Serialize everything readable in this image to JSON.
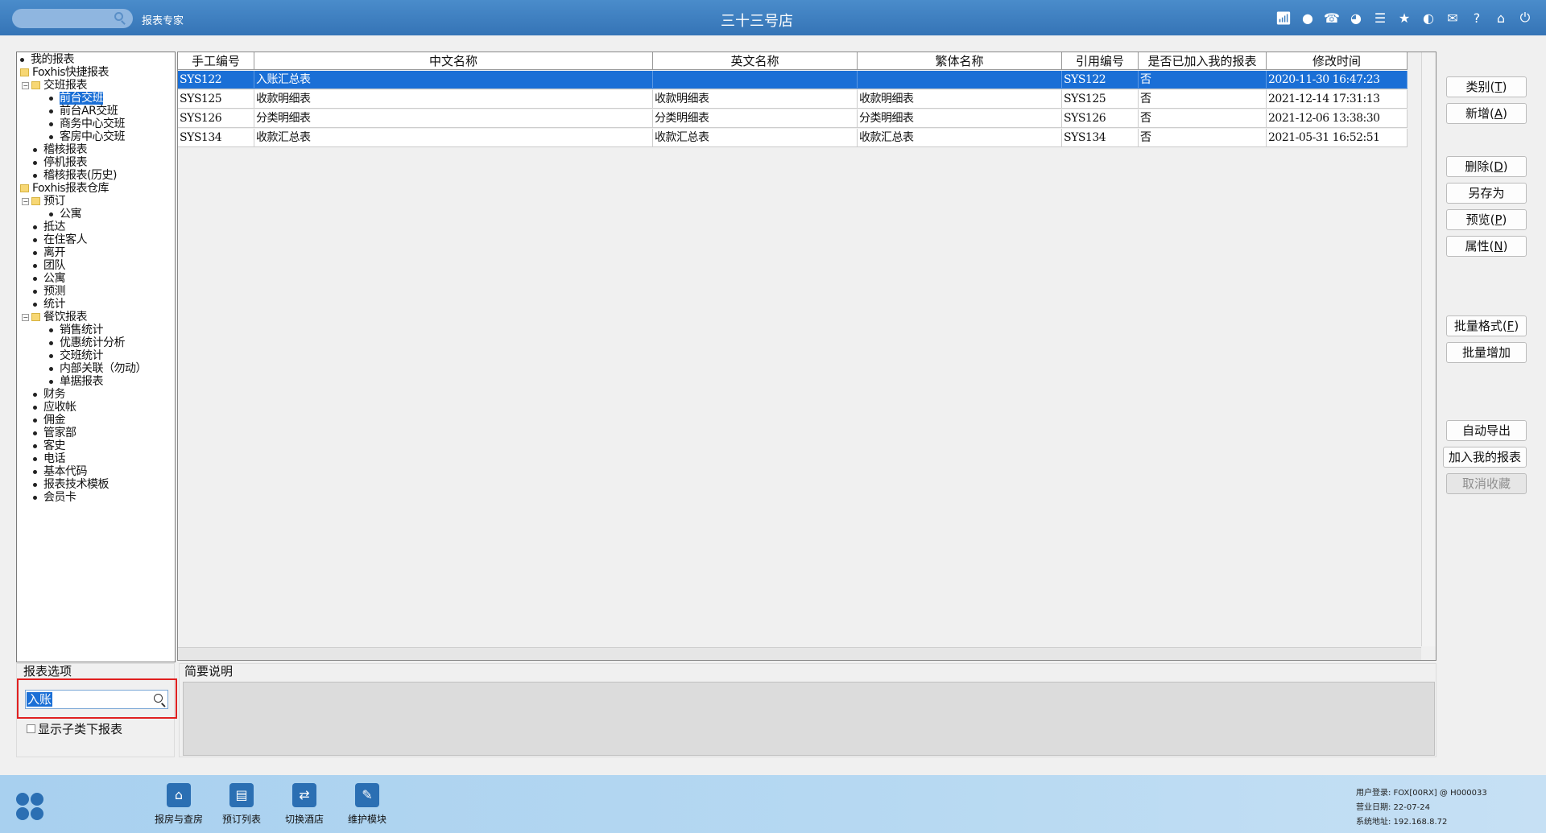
{
  "topbar": {
    "app_name": "报表专家",
    "hotel_name": "三十三号店",
    "icons": [
      "wifi-icon",
      "chat-icon",
      "phone-icon",
      "palette-icon",
      "menu-icon",
      "star-icon",
      "theme-icon",
      "mail-icon",
      "help-icon",
      "home-icon",
      "power-icon"
    ]
  },
  "tree": {
    "items": [
      {
        "label": "我的报表",
        "level": 0,
        "type": "bullet"
      },
      {
        "label": "Foxhis快捷报表",
        "level": 0,
        "type": "folder"
      },
      {
        "label": "交班报表",
        "level": 1,
        "type": "folder",
        "toggle": "⊟"
      },
      {
        "label": "前台交班",
        "level": 2,
        "type": "bullet",
        "selected": true
      },
      {
        "label": "前台AR交班",
        "level": 2,
        "type": "bullet"
      },
      {
        "label": "商务中心交班",
        "level": 2,
        "type": "bullet"
      },
      {
        "label": "客房中心交班",
        "level": 2,
        "type": "bullet"
      },
      {
        "label": "稽核报表",
        "level": 1,
        "type": "bullet"
      },
      {
        "label": "停机报表",
        "level": 1,
        "type": "bullet"
      },
      {
        "label": "稽核报表(历史)",
        "level": 1,
        "type": "bullet"
      },
      {
        "label": "Foxhis报表仓库",
        "level": 0,
        "type": "folder"
      },
      {
        "label": "预订",
        "level": 1,
        "type": "folder",
        "toggle": "⊟"
      },
      {
        "label": "公寓",
        "level": 2,
        "type": "bullet"
      },
      {
        "label": "抵达",
        "level": 1,
        "type": "bullet"
      },
      {
        "label": "在住客人",
        "level": 1,
        "type": "bullet"
      },
      {
        "label": "离开",
        "level": 1,
        "type": "bullet"
      },
      {
        "label": "团队",
        "level": 1,
        "type": "bullet"
      },
      {
        "label": "公寓",
        "level": 1,
        "type": "bullet"
      },
      {
        "label": "预测",
        "level": 1,
        "type": "bullet"
      },
      {
        "label": "统计",
        "level": 1,
        "type": "bullet"
      },
      {
        "label": "餐饮报表",
        "level": 1,
        "type": "folder",
        "toggle": "⊟"
      },
      {
        "label": "销售统计",
        "level": 2,
        "type": "bullet"
      },
      {
        "label": "优惠统计分析",
        "level": 2,
        "type": "bullet"
      },
      {
        "label": "交班统计",
        "level": 2,
        "type": "bullet"
      },
      {
        "label": "内部关联（勿动）",
        "level": 2,
        "type": "bullet"
      },
      {
        "label": "单据报表",
        "level": 2,
        "type": "bullet"
      },
      {
        "label": "财务",
        "level": 1,
        "type": "bullet"
      },
      {
        "label": "应收帐",
        "level": 1,
        "type": "bullet"
      },
      {
        "label": "佣金",
        "level": 1,
        "type": "bullet"
      },
      {
        "label": "管家部",
        "level": 1,
        "type": "bullet"
      },
      {
        "label": "客史",
        "level": 1,
        "type": "bullet"
      },
      {
        "label": "电话",
        "level": 1,
        "type": "bullet"
      },
      {
        "label": "基本代码",
        "level": 1,
        "type": "bullet"
      },
      {
        "label": "报表技术模板",
        "level": 1,
        "type": "bullet"
      },
      {
        "label": "会员卡",
        "level": 1,
        "type": "bullet"
      }
    ]
  },
  "grid": {
    "columns": [
      "手工编号",
      "中文名称",
      "英文名称",
      "繁体名称",
      "引用编号",
      "是否已加入我的报表",
      "修改时间"
    ],
    "rows": [
      [
        "SYS122",
        "入账汇总表",
        "",
        "",
        "SYS122",
        "否",
        "2020-11-30 16:47:23"
      ],
      [
        "SYS125",
        "收款明细表",
        "收款明细表",
        "收款明细表",
        "SYS125",
        "否",
        "2021-12-14 17:31:13"
      ],
      [
        "SYS126",
        "分类明细表",
        "分类明细表",
        "分类明细表",
        "SYS126",
        "否",
        "2021-12-06 13:38:30"
      ],
      [
        "SYS134",
        "收款汇总表",
        "收款汇总表",
        "收款汇总表",
        "SYS134",
        "否",
        "2021-05-31 16:52:51"
      ]
    ]
  },
  "buttons": {
    "category": {
      "text": "类别(",
      "key": "T",
      "end": ")"
    },
    "add": {
      "text": "新增(",
      "key": "A",
      "end": ")"
    },
    "delete": {
      "text": "删除(",
      "key": "D",
      "end": ")"
    },
    "save_as": {
      "text": "另存为"
    },
    "preview": {
      "text": "预览(",
      "key": "P",
      "end": ")"
    },
    "properties": {
      "text": "属性(",
      "key": "N",
      "end": ")"
    },
    "batch_format": {
      "text": "批量格式(",
      "key": "F",
      "end": ")"
    },
    "batch_add": {
      "text": "批量增加"
    },
    "auto_export": {
      "text": "自动导出"
    },
    "add_to_my_reports": {
      "text": "加入我的报表"
    },
    "cancel_favorite": {
      "text": "取消收藏"
    }
  },
  "options": {
    "label": "报表选项",
    "search_value": "入账",
    "show_sub_label": "显示子类下报表"
  },
  "description": {
    "label": "简要说明"
  },
  "taskbar": {
    "items": [
      {
        "label": "报房与查房",
        "icon": "house-search-icon",
        "glyph": "⌂"
      },
      {
        "label": "预订列表",
        "icon": "booking-list-icon",
        "glyph": "▤"
      },
      {
        "label": "切换酒店",
        "icon": "switch-icon",
        "glyph": "⇄"
      },
      {
        "label": "维护模块",
        "icon": "wrench-icon",
        "glyph": "✎"
      }
    ],
    "sysinfo": {
      "user": "用户登录:  FOX[00RX] @ H000033",
      "business_date": "营业日期:  22-07-24",
      "address": "系统地址:  192.168.8.72"
    }
  }
}
